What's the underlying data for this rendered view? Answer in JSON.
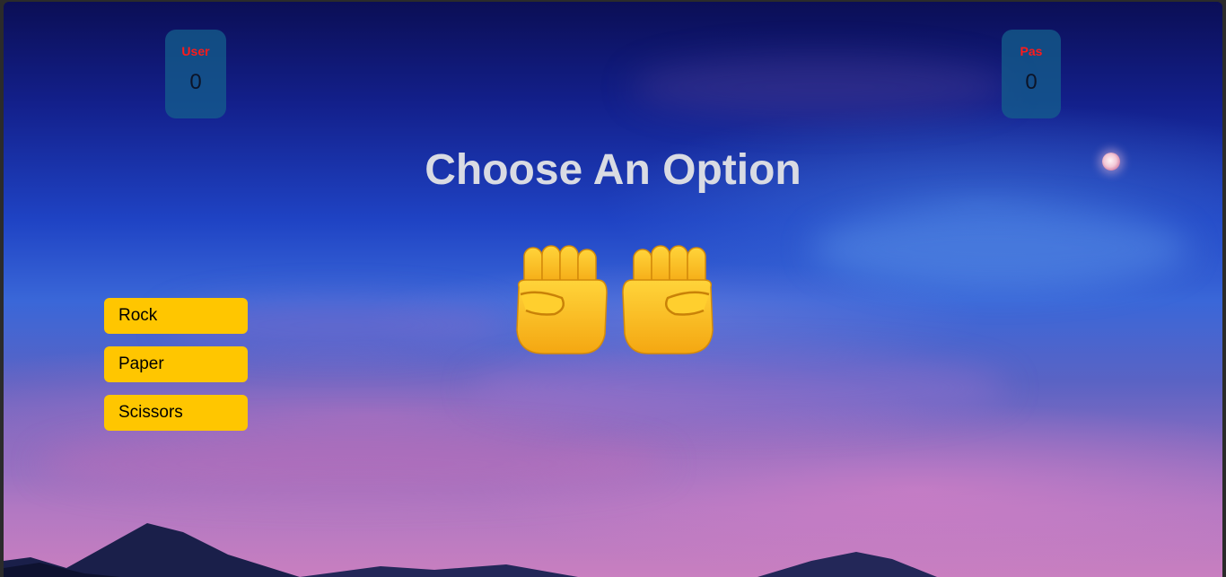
{
  "game": {
    "title": "Choose An Option",
    "scores": {
      "user": {
        "label": "User",
        "value": "0"
      },
      "pas": {
        "label": "Pas",
        "value": "0"
      }
    },
    "choices": [
      "Rock",
      "Paper",
      "Scissors"
    ],
    "hands": {
      "user_hand": "raised-fist",
      "computer_hand": "raised-fist"
    }
  },
  "colors": {
    "button_bg": "#ffc600",
    "score_label": "#ff1a1a",
    "score_card_bg": "#145f8c",
    "title_text": "#d9dbe3"
  }
}
